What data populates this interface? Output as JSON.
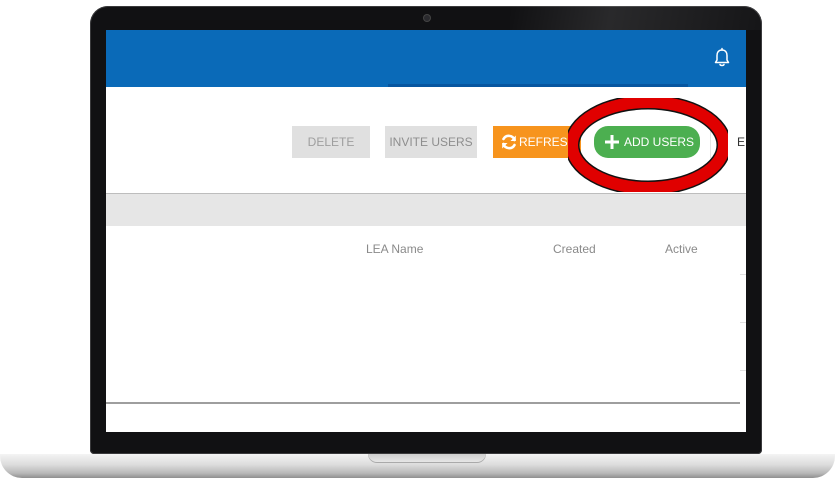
{
  "toolbar": {
    "delete_label": "DELETE",
    "invite_label": "INVITE USERS",
    "refresh_label": "REFRES",
    "add_label": "ADD USERS",
    "export_label": "E"
  },
  "table": {
    "columns": [
      "LEA Name",
      "Created",
      "Active"
    ]
  },
  "icons": {
    "bell": "bell-icon",
    "refresh": "refresh-icon",
    "add": "plus-icon",
    "export": "export-icon"
  },
  "colors": {
    "header": "#0a6ab8",
    "refresh": "#f7941d",
    "add": "#4caf50",
    "annotation": "#e00000"
  }
}
